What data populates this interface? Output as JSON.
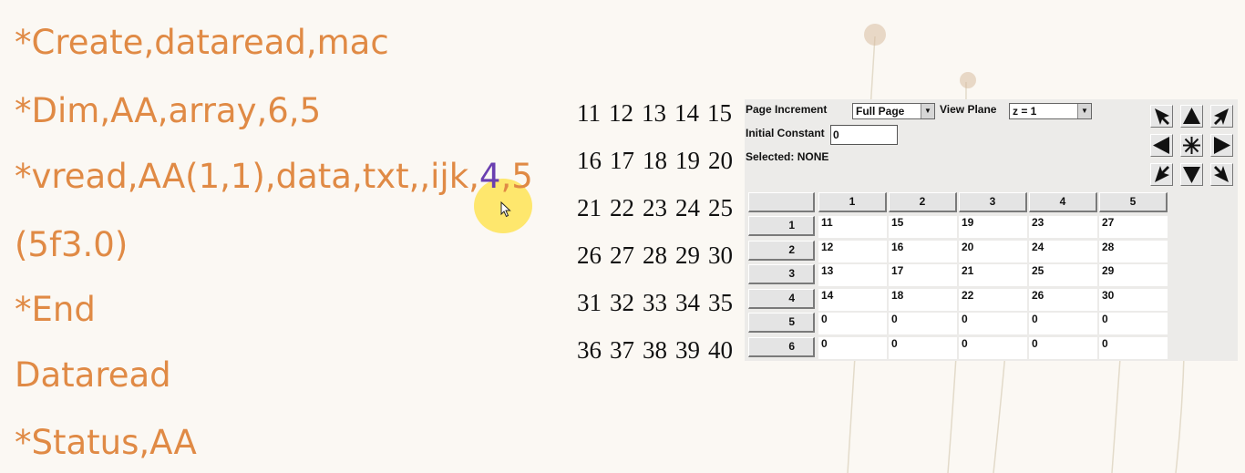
{
  "macro": {
    "lines": [
      "*Create,dataread,mac",
      "*Dim,AA,array,6,5",
      "*vread,AA(1,1),data,txt,,ijk,",
      "(5f3.0)",
      "*End",
      "Dataread",
      "*Status,AA"
    ],
    "vread_highlight": "4",
    "vread_tail": ",5"
  },
  "data_file": {
    "rows": [
      [
        "11",
        "12",
        "13",
        "14",
        "15"
      ],
      [
        "16",
        "17",
        "18",
        "19",
        "20"
      ],
      [
        "21",
        "22",
        "23",
        "24",
        "25"
      ],
      [
        "26",
        "27",
        "28",
        "29",
        "30"
      ],
      [
        "31",
        "32",
        "33",
        "34",
        "35"
      ],
      [
        "36",
        "37",
        "38",
        "39",
        "40"
      ]
    ]
  },
  "dialog": {
    "page_increment_label": "Page Increment",
    "page_increment_value": "Full Page",
    "view_plane_label": "View Plane",
    "view_plane_value": "z = 1",
    "initial_constant_label": "Initial Constant",
    "initial_constant_value": "0",
    "selected_label": "Selected: NONE",
    "nav_icons": [
      "up-left-arrow-icon",
      "up-arrow-icon",
      "up-right-arrow-icon",
      "left-arrow-icon",
      "center-star-icon",
      "right-arrow-icon",
      "down-left-arrow-icon",
      "down-arrow-icon",
      "down-right-arrow-icon"
    ],
    "column_headers": [
      "1",
      "2",
      "3",
      "4",
      "5"
    ],
    "row_headers": [
      "1",
      "2",
      "3",
      "4",
      "5",
      "6"
    ],
    "cells": [
      [
        "11",
        "15",
        "19",
        "23",
        "27"
      ],
      [
        "12",
        "16",
        "20",
        "24",
        "28"
      ],
      [
        "13",
        "17",
        "21",
        "25",
        "29"
      ],
      [
        "14",
        "18",
        "22",
        "26",
        "30"
      ],
      [
        "0",
        "0",
        "0",
        "0",
        "0"
      ],
      [
        "0",
        "0",
        "0",
        "0",
        "0"
      ]
    ]
  },
  "colors": {
    "code_text": "#e08a45",
    "code_highlight": "#6a3fb0",
    "pointer_highlight": "#ffe146",
    "dialog_bg": "#ecebe9"
  }
}
